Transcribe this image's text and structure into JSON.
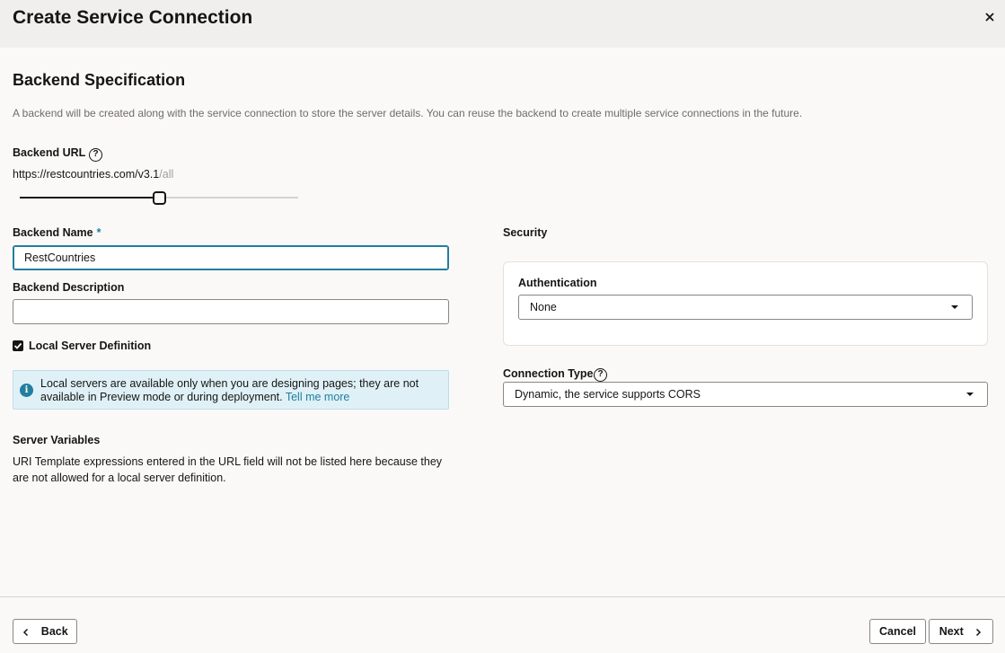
{
  "dialog": {
    "title": "Create Service Connection",
    "close_icon": "close-icon"
  },
  "section": {
    "title": "Backend Specification",
    "description": "A backend will be created along with the service connection to store the server details. You can reuse the backend to create multiple service connections in the future."
  },
  "backend_url": {
    "label": "Backend URL",
    "help": "?",
    "base": "https://restcountries.com/v3.1",
    "path": "/all",
    "slider_fraction": 0.5
  },
  "backend_name": {
    "label": "Backend Name",
    "required_marker": "*",
    "value": "RestCountries"
  },
  "backend_description": {
    "label": "Backend Description",
    "value": ""
  },
  "local_server": {
    "label": "Local Server Definition",
    "checked": true
  },
  "info_message": {
    "icon": "i",
    "text": "Local servers are available only when you are designing pages; they are not available in Preview mode or during deployment.",
    "link": "Tell me more"
  },
  "server_variables": {
    "title": "Server Variables",
    "text": "URI Template expressions entered in the URL field will not be listed here because they are not allowed for a local server definition."
  },
  "security": {
    "label": "Security",
    "authentication_label": "Authentication",
    "authentication_value": "None"
  },
  "connection_type": {
    "label": "Connection Type",
    "help": "?",
    "value": "Dynamic, the service supports CORS"
  },
  "footer": {
    "back": "Back",
    "cancel": "Cancel",
    "next": "Next"
  },
  "colors": {
    "accent": "#227e9e",
    "info_background": "#dff1f7",
    "header_background": "#f1efed"
  }
}
